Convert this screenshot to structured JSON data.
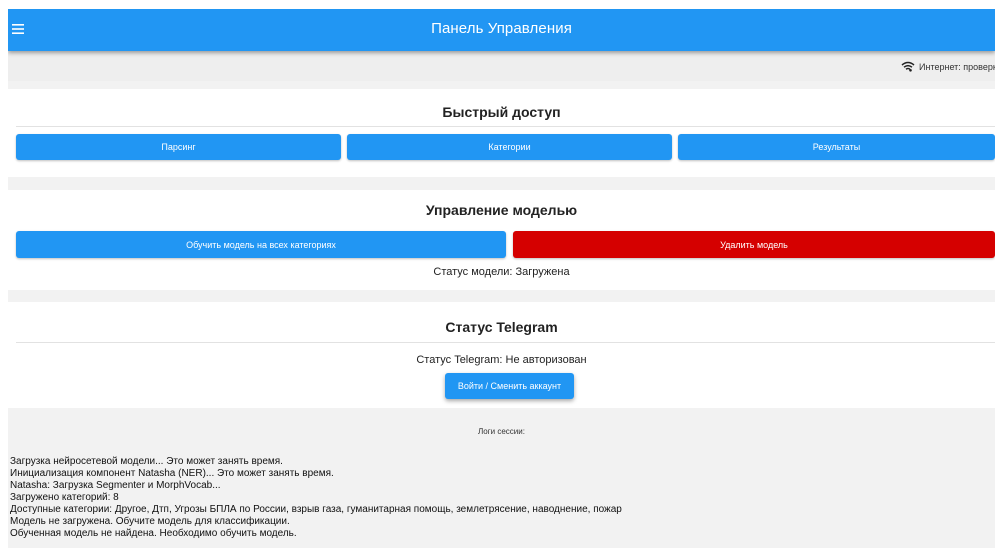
{
  "appbar": {
    "title": "Панель Управления",
    "menu_icon": "menu-icon"
  },
  "connection": {
    "text": "Интернет: проверка",
    "icon": "wifi-icon"
  },
  "quick_access": {
    "title": "Быстрый доступ",
    "buttons": [
      "Парсинг",
      "Категории",
      "Результаты"
    ]
  },
  "model": {
    "title": "Управление моделью",
    "train_label": "Обучить модель на всех категориях",
    "delete_label": "Удалить модель",
    "status": "Статус модели: Загружена"
  },
  "telegram": {
    "title": "Статус Telegram",
    "status": "Статус Telegram: Не авторизован",
    "login_label": "Войти / Сменить аккаунт"
  },
  "logs": {
    "label": "Логи сессии:",
    "lines": [
      "Загрузка нейросетевой модели... Это может занять время.",
      "Инициализация компонент Natasha (NER)... Это может занять время.",
      "Natasha: Загрузка Segmenter и MorphVocab...",
      "Загружено категорий: 8",
      "Доступные категории: Другое, Дтп, Угрозы БПЛА по России, взрыв газа, гуманитарная помощь, землетрясение, наводнение, пожар",
      "Модель не загружена. Обучите модель для классификации.",
      "Обученная модель не найдена. Необходимо обучить модель."
    ]
  },
  "colors": {
    "primary": "#2196f3",
    "danger": "#d50000",
    "background": "#f2f2f2"
  }
}
